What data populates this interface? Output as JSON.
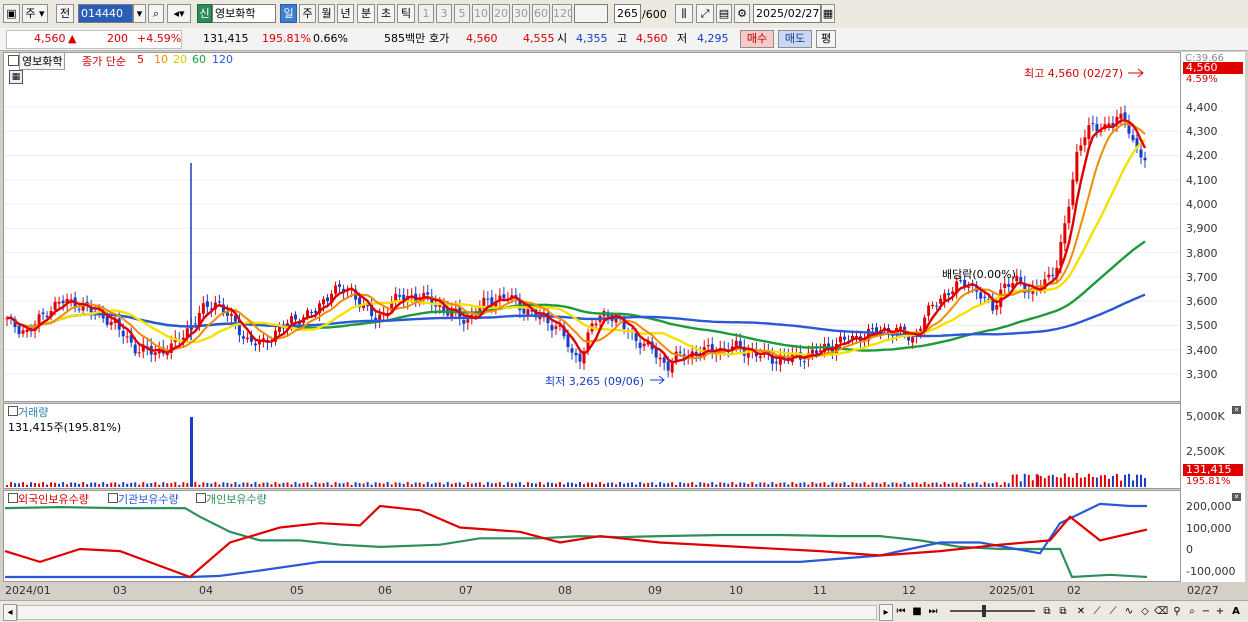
{
  "toolbar": {
    "period": "주",
    "tab_all": "전",
    "code": "014440",
    "new_badge": "신",
    "stock_name": "영보화학",
    "periods": [
      "일",
      "주",
      "월",
      "년",
      "분",
      "초",
      "틱"
    ],
    "intervals": [
      "1",
      "3",
      "5",
      "10",
      "20",
      "30",
      "60",
      "120"
    ],
    "count": "265",
    "count_total": "/600",
    "date": "2025/02/27"
  },
  "quote": {
    "price": "4,560",
    "change": "200",
    "change_pct": "+4.59%",
    "volume": "131,415",
    "volume_ratio": "195.81%",
    "turnover": "0.66%",
    "amount": "585백만",
    "bid_label": "호가",
    "bid1": "4,560",
    "bid2": "4,555",
    "open_label": "시",
    "open": "4,355",
    "high_label": "고",
    "high": "4,560",
    "low_label": "저",
    "low": "4,295",
    "buy": "매수",
    "sell": "매도",
    "avg": "평"
  },
  "price_panel": {
    "name": "영보화학",
    "ma_title": "종가 단순",
    "ma_periods": [
      "5",
      "10",
      "20",
      "60",
      "120"
    ],
    "high_label": "최고 4,560 (02/27)",
    "low_label": "최저 3,265 (09/06)",
    "dividend_label": "배당락(0.00%)",
    "axis_top": "C:39.66",
    "axis_price": "4,560",
    "axis_pct": "4.59%",
    "y_ticks": [
      "4,400",
      "4,300",
      "4,200",
      "4,100",
      "4,000",
      "3,900",
      "3,800",
      "3,700",
      "3,600",
      "3,500",
      "3,400",
      "3,300"
    ]
  },
  "volume_panel": {
    "title": "거래량",
    "info": "131,415주(195.81%)",
    "y_ticks": [
      "5,000K",
      "2,500K"
    ],
    "axis_value": "131,415",
    "axis_pct": "195.81%"
  },
  "holdings_panel": {
    "legend": [
      "외국인보유수량",
      "기관보유수량",
      "개인보유수량"
    ],
    "y_ticks": [
      "200,000",
      "100,000",
      "0",
      "-100,000"
    ]
  },
  "x_axis": [
    "2024/01",
    "03",
    "04",
    "05",
    "06",
    "07",
    "08",
    "09",
    "10",
    "11",
    "12",
    "2025/01",
    "02",
    "02/27"
  ],
  "colors": {
    "ma5": "#e00000",
    "ma10": "#f08c00",
    "ma20": "#f5e100",
    "ma60": "#1f9a3a",
    "ma120": "#2a58d8",
    "up": "#e00000",
    "down": "#1a3cc8",
    "foreign": "#e00000",
    "institution": "#2a58d8",
    "individual": "#2f8f5a"
  }
}
